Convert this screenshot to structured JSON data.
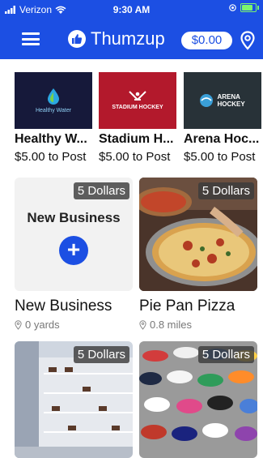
{
  "status_bar": {
    "carrier": "Verizon",
    "time": "9:30 AM"
  },
  "header": {
    "brand": "Thumzup",
    "balance": "$0.00"
  },
  "featured": [
    {
      "logo_text": "Healthy Water",
      "title": "Healthy W...",
      "price": "$5.00 to Post"
    },
    {
      "logo_text": "STADIUM HOCKEY",
      "title": "Stadium H...",
      "price": "$5.00 to Post"
    },
    {
      "logo_text": "ARENA HOCKEY",
      "title": "Arena Hoc...",
      "price": "$5.00 to Post"
    }
  ],
  "cards": [
    {
      "badge": "5 Dollars",
      "title": "New Business",
      "distance": "0 yards",
      "image_text": "New Business"
    },
    {
      "badge": "5 Dollars",
      "title": "Pie Pan Pizza",
      "distance": "0.8 miles"
    },
    {
      "badge": "5 Dollars"
    },
    {
      "badge": "5 Dollars"
    }
  ]
}
